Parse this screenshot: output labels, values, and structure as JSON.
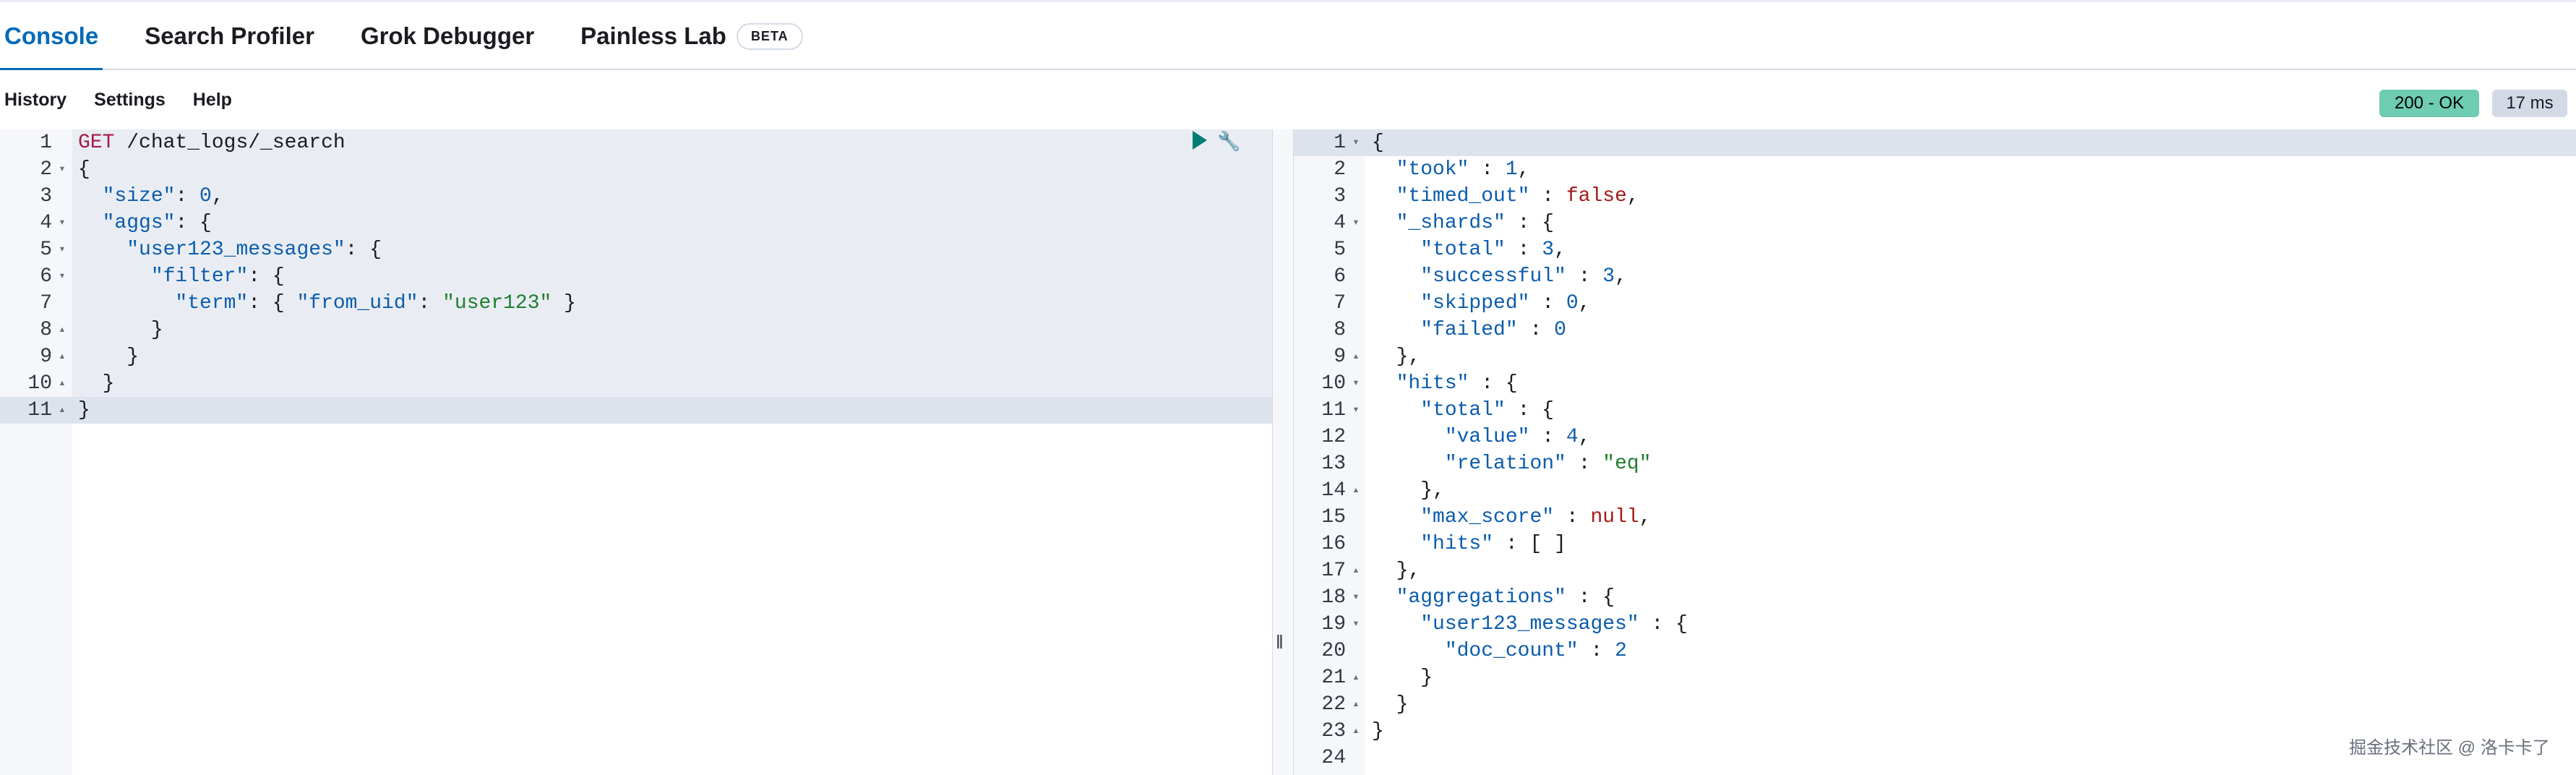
{
  "tabs": [
    "Console",
    "Search Profiler",
    "Grok Debugger",
    "Painless Lab"
  ],
  "beta_label": "BETA",
  "toolbar": {
    "history": "History",
    "settings": "Settings",
    "help": "Help"
  },
  "status": {
    "code": "200 - OK",
    "time": "17 ms"
  },
  "icons": {
    "run": "play-icon",
    "options": "wrench-icon"
  },
  "request_lines": [
    "GET /chat_logs/_search",
    "{",
    "  \"size\": 0,",
    "  \"aggs\": {",
    "    \"user123_messages\": {",
    "      \"filter\": {",
    "        \"term\": { \"from_uid\": \"user123\" }",
    "      }",
    "    }",
    "  }",
    "}"
  ],
  "response_lines": [
    "{",
    "  \"took\" : 1,",
    "  \"timed_out\" : false,",
    "  \"_shards\" : {",
    "    \"total\" : 3,",
    "    \"successful\" : 3,",
    "    \"skipped\" : 0,",
    "    \"failed\" : 0",
    "  },",
    "  \"hits\" : {",
    "    \"total\" : {",
    "      \"value\" : 4,",
    "      \"relation\" : \"eq\"",
    "    },",
    "    \"max_score\" : null,",
    "    \"hits\" : [ ]",
    "  },",
    "  \"aggregations\" : {",
    "    \"user123_messages\" : {",
    "      \"doc_count\" : 2",
    "    }",
    "  }",
    "}",
    ""
  ],
  "watermark": "掘金技术社区 @ 洛卡卡了",
  "colors": {
    "accent": "#006bb8",
    "ok_badge": "#6dccb1",
    "string": "#1e7d2e",
    "keyword": "#a51a4a"
  }
}
